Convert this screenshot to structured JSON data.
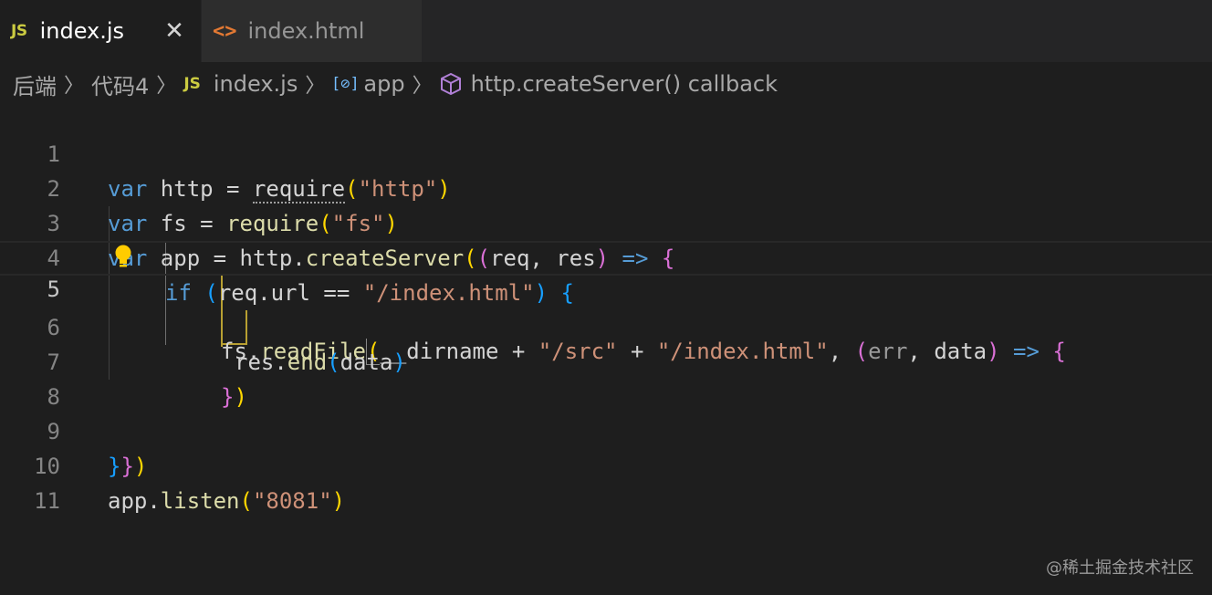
{
  "tabs": [
    {
      "icon": "js-file-icon",
      "badge": "JS",
      "label": "index.js",
      "active": true,
      "close": "✕"
    },
    {
      "icon": "html-file-icon",
      "badge": "<>",
      "label": "index.html",
      "active": false
    }
  ],
  "breadcrumb": {
    "folder1": "后端",
    "folder2": "代码4",
    "file_badge": "JS",
    "file": "index.js",
    "symbol1_icon": "[⊘]",
    "symbol1": "app",
    "symbol2": "http.createServer() callback"
  },
  "line_numbers": [
    "1",
    "2",
    "3",
    "4",
    "5",
    "6",
    "7",
    "8",
    "9",
    "10",
    "11"
  ],
  "code": {
    "l1": {
      "kw": "var",
      "a": " http = ",
      "req": "require",
      "p1": "(",
      "s": "\"http\"",
      "p2": ")"
    },
    "l2": {
      "kw": "var",
      "a": " fs = ",
      "fn": "require",
      "p1": "(",
      "s": "\"fs\"",
      "p2": ")"
    },
    "l3": {
      "kw": "var",
      "a": " app = http.",
      "fn": "createServer",
      "p1": "(",
      "p2": "(",
      "args": "req, res",
      "p3": ")",
      "arrow": " => ",
      "p4": "{"
    },
    "l4": {
      "kw": "if",
      "a": " ",
      "p1": "(",
      "cond": "req.url == ",
      "s": "\"/index.html\"",
      "p2": ")",
      "sp": " ",
      "p3": "{"
    },
    "l5": {
      "a": "fs.",
      "fn": "readFile",
      "p1": "(",
      "b": "__dirname + ",
      "s1": "\"/src\"",
      "c": " + ",
      "s2": "\"/index.html\"",
      "d": ", ",
      "p2": "(",
      "args1": "err",
      "comma": ", ",
      "args2": "data",
      "p3": ")",
      "arrow": " => ",
      "p4": "{"
    },
    "l6": {
      "a": "res.",
      "fn": "end",
      "p1": "(",
      "arg": "data",
      "p2": ")"
    },
    "l7": {
      "p1": "}",
      "p2": ")"
    },
    "l9": {
      "p1": "}",
      "p2": "}",
      "p3": ")"
    },
    "l10": {
      "a": "app.",
      "fn": "listen",
      "p1": "(",
      "s": "\"8081\"",
      "p2": ")"
    }
  },
  "watermark": "@稀土掘金技术社区",
  "colors": {
    "background": "#1e1e1e",
    "keyword": "#569cd6",
    "function": "#dcdcaa",
    "string": "#ce9178",
    "bracket1": "#ffd700",
    "bracket2": "#da70d6",
    "bracket3": "#179fff"
  }
}
